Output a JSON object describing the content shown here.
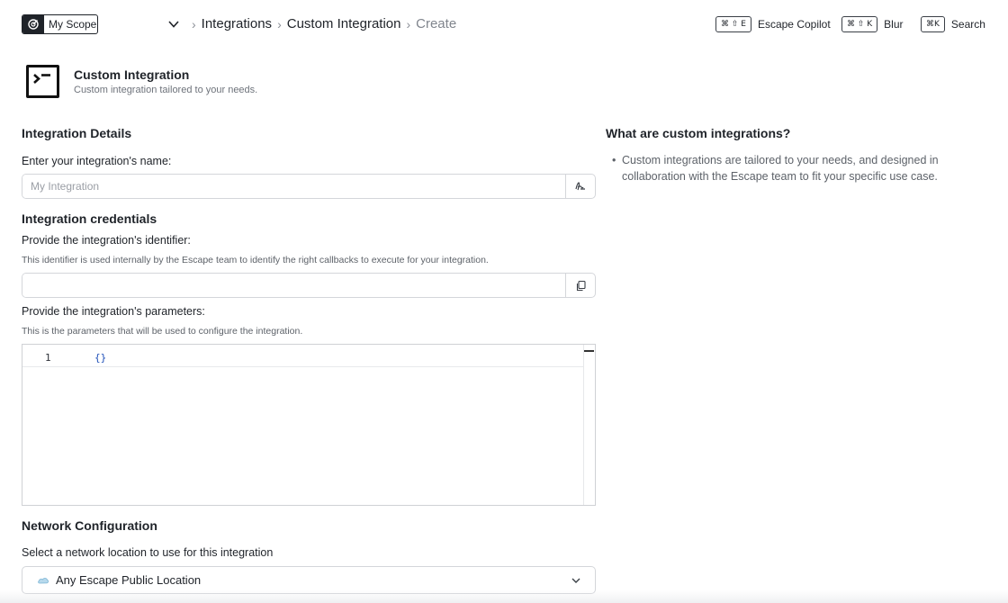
{
  "topbar": {
    "scope_label": "My Scope",
    "breadcrumbs": [
      "Integrations",
      "Custom Integration",
      "Create"
    ],
    "shortcuts": [
      {
        "keys": "⌘ ⇧ E",
        "label": "Escape Copilot"
      },
      {
        "keys": "⌘ ⇧ K",
        "label": "Blur"
      },
      {
        "keys": "⌘K",
        "label": "Search"
      }
    ]
  },
  "header": {
    "title": "Custom Integration",
    "subtitle": "Custom integration tailored to your needs.",
    "icon": "terminal-icon"
  },
  "details": {
    "section_title": "Integration Details",
    "name_label": "Enter your integration's name:",
    "name_placeholder": "My Integration",
    "name_value": ""
  },
  "credentials": {
    "section_title": "Integration credentials",
    "identifier_label": "Provide the integration's identifier:",
    "identifier_help": "This identifier is used internally by the Escape team to identify the right callbacks to execute for your integration.",
    "identifier_value": "",
    "parameters_label": "Provide the integration's parameters:",
    "parameters_help": "This is the parameters that will be used to configure the integration.",
    "editor": {
      "line_number": "1",
      "code": "{}"
    }
  },
  "network": {
    "section_title": "Network Configuration",
    "location_label": "Select a network location to use for this integration",
    "selected_location": "Any Escape Public Location"
  },
  "aside": {
    "title": "What are custom integrations?",
    "items": [
      "Custom integrations are tailored to your needs, and designed in collaboration with the Escape team to fit your specific use case."
    ]
  },
  "colors": {
    "text": "#1f2329",
    "muted": "#6e737b",
    "code_blue": "#1e4fb8",
    "border": "#d4d6da"
  }
}
